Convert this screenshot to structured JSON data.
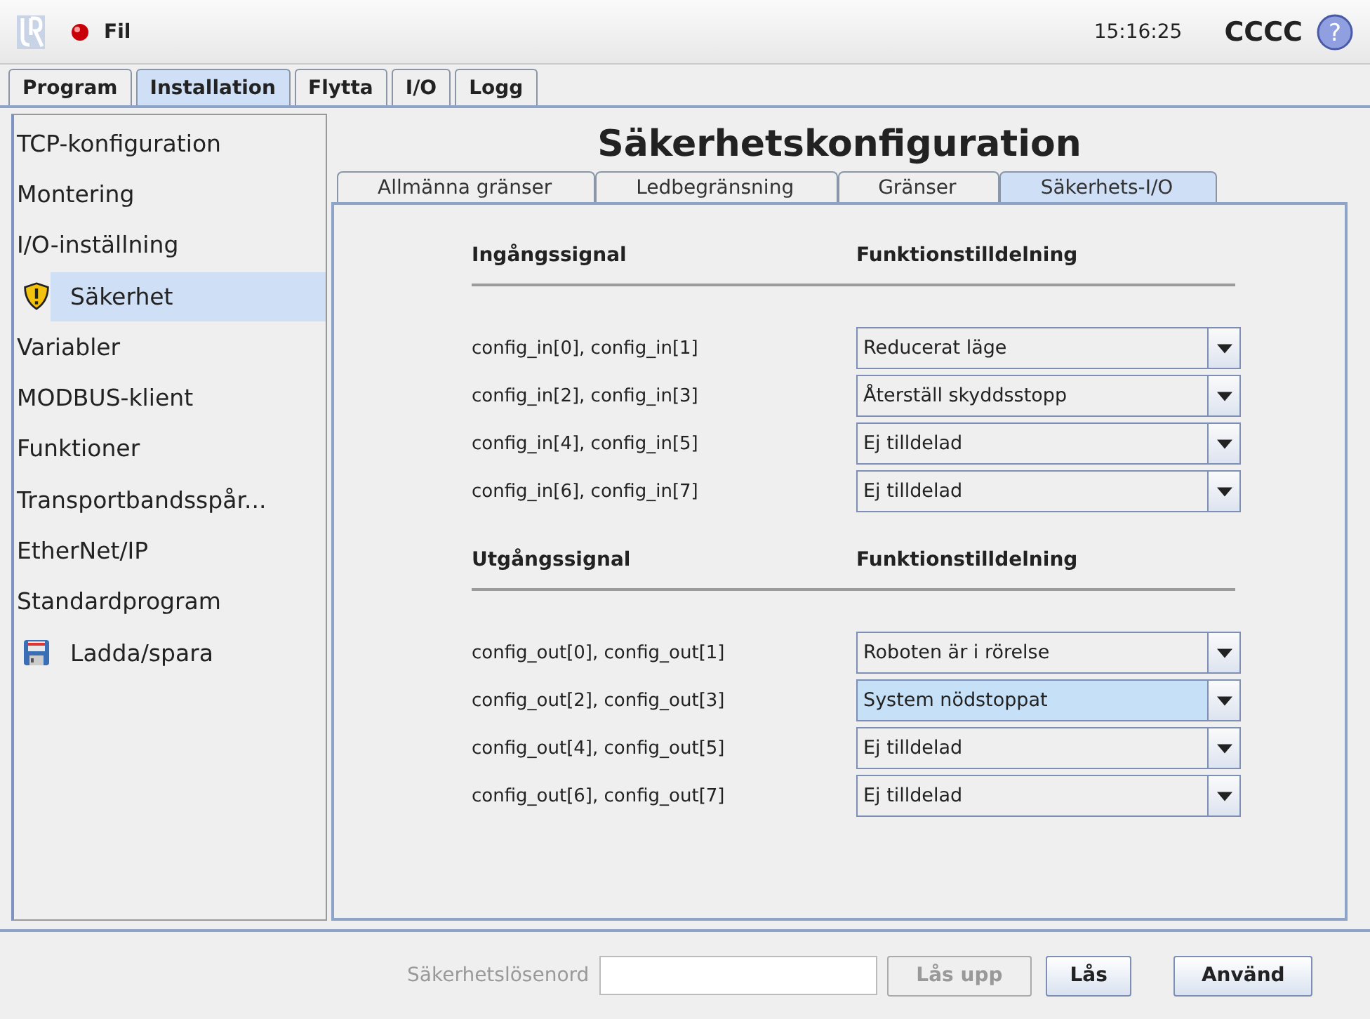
{
  "header": {
    "menu": "Fil",
    "time": "15:16:25",
    "robot_name": "CCCC",
    "help": "?"
  },
  "tabs": [
    {
      "label": "Program",
      "selected": false
    },
    {
      "label": "Installation",
      "selected": true
    },
    {
      "label": "Flytta",
      "selected": false
    },
    {
      "label": "I/O",
      "selected": false
    },
    {
      "label": "Logg",
      "selected": false
    }
  ],
  "sidebar": {
    "items": [
      {
        "label": "TCP-konfiguration",
        "kind": "text",
        "selected": false
      },
      {
        "label": "Montering",
        "kind": "text",
        "selected": false
      },
      {
        "label": "I/O-inställning",
        "kind": "text",
        "selected": false
      },
      {
        "label": "Säkerhet",
        "kind": "warning",
        "selected": true
      },
      {
        "label": "Variabler",
        "kind": "text",
        "selected": false
      },
      {
        "label": "MODBUS-klient",
        "kind": "text",
        "selected": false
      },
      {
        "label": "Funktioner",
        "kind": "text",
        "selected": false
      },
      {
        "label": "Transportbandsspår...",
        "kind": "text",
        "selected": false
      },
      {
        "label": "EtherNet/IP",
        "kind": "text",
        "selected": false
      },
      {
        "label": "Standardprogram",
        "kind": "text",
        "selected": false
      },
      {
        "label": "Ladda/spara",
        "kind": "disk",
        "selected": false
      }
    ]
  },
  "title": "Säkerhetskonfiguration",
  "subtabs": [
    {
      "label": "Allmänna gränser",
      "selected": false
    },
    {
      "label": "Ledbegränsning",
      "selected": false
    },
    {
      "label": "Gränser",
      "selected": false
    },
    {
      "label": "Säkerhets-I/O",
      "selected": true
    }
  ],
  "sections": [
    {
      "signal_heading": "Ingångssignal",
      "function_heading": "Funktionstilldelning",
      "rows": [
        {
          "signal": "config_in[0], config_in[1]",
          "value": "Reducerat läge",
          "focused": false
        },
        {
          "signal": "config_in[2], config_in[3]",
          "value": "Återställ skyddsstopp",
          "focused": false
        },
        {
          "signal": "config_in[4], config_in[5]",
          "value": "Ej tilldelad",
          "focused": false
        },
        {
          "signal": "config_in[6], config_in[7]",
          "value": "Ej tilldelad",
          "focused": false
        }
      ]
    },
    {
      "signal_heading": "Utgångssignal",
      "function_heading": "Funktionstilldelning",
      "rows": [
        {
          "signal": "config_out[0], config_out[1]",
          "value": "Roboten är i rörelse",
          "focused": false
        },
        {
          "signal": "config_out[2], config_out[3]",
          "value": "System nödstoppat",
          "focused": true
        },
        {
          "signal": "config_out[4], config_out[5]",
          "value": "Ej tilldelad",
          "focused": false
        },
        {
          "signal": "config_out[6], config_out[7]",
          "value": "Ej tilldelad",
          "focused": false
        }
      ]
    }
  ],
  "footer": {
    "password_label": "Säkerhetslösenord",
    "buttons": [
      {
        "label": "Lås upp",
        "disabled": true
      },
      {
        "label": "Lås",
        "disabled": false
      },
      {
        "label": "Använd",
        "disabled": false
      }
    ]
  }
}
